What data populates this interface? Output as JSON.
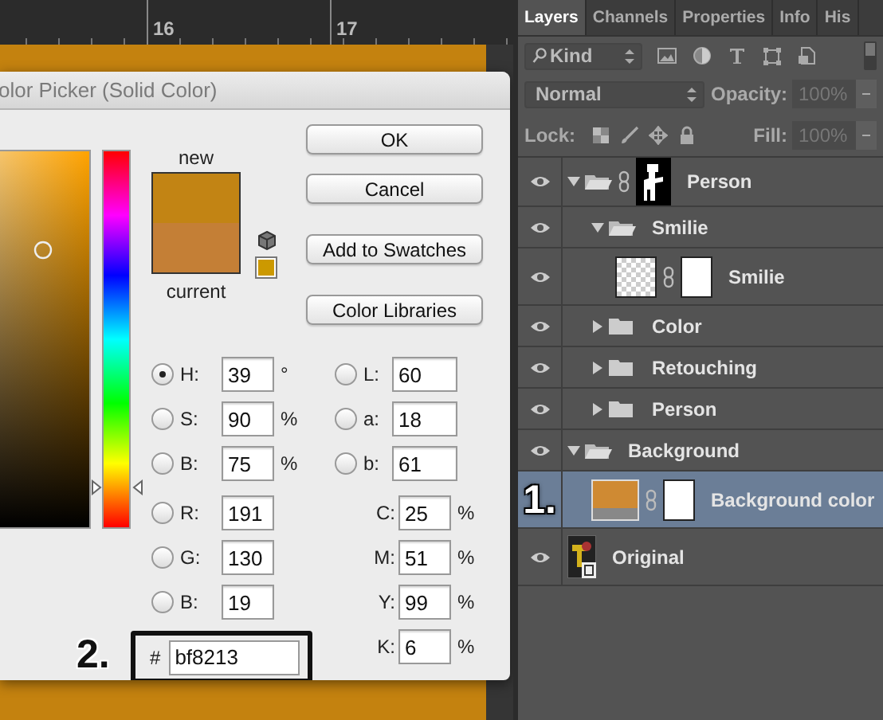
{
  "ruler": {
    "labels": [
      "16",
      "17"
    ]
  },
  "dialog": {
    "title": "olor Picker (Solid Color)",
    "hue_slider": {
      "level": 0.108
    },
    "swatches": [
      {
        "label": "new",
        "color": "#c28414"
      },
      {
        "label": "current",
        "color": "#c47f36"
      }
    ],
    "buttons": [
      "OK",
      "Cancel",
      "Add to Swatches",
      "Color Libraries"
    ],
    "left_fields": [
      {
        "label": "H:",
        "value": "39",
        "unit": "°",
        "kind": "radio",
        "selected": true
      },
      {
        "label": "S:",
        "value": "90",
        "unit": "%",
        "kind": "radio",
        "selected": false
      },
      {
        "label": "B:",
        "value": "75",
        "unit": "%",
        "kind": "radio",
        "selected": false
      },
      {
        "label": "R:",
        "value": "191",
        "kind": "radio",
        "selected": false
      },
      {
        "label": "G:",
        "value": "130",
        "kind": "radio",
        "selected": false
      },
      {
        "label": "B:",
        "value": "19",
        "kind": "radio",
        "selected": false
      }
    ],
    "right_fields": [
      {
        "label": "L:",
        "value": "60",
        "kind": "radio",
        "selected": false
      },
      {
        "label": "a:",
        "value": "18",
        "kind": "radio",
        "selected": false
      },
      {
        "label": "b:",
        "value": "61",
        "kind": "radio",
        "selected": false
      },
      {
        "label": "C:",
        "value": "25",
        "unit": "%",
        "kind": "plain"
      },
      {
        "label": "M:",
        "value": "51",
        "unit": "%",
        "kind": "plain"
      },
      {
        "label": "Y:",
        "value": "99",
        "unit": "%",
        "kind": "plain"
      },
      {
        "label": "K:",
        "value": "6",
        "unit": "%",
        "kind": "plain"
      }
    ],
    "hex": {
      "label": "#",
      "value": "bf8213",
      "callout": "2."
    }
  },
  "panel": {
    "tabs": [
      {
        "label": "Layers",
        "selected": true
      },
      {
        "label": "Channels",
        "selected": false
      },
      {
        "label": "Properties",
        "selected": false
      },
      {
        "label": "Info",
        "selected": false
      },
      {
        "label": "His",
        "selected": false
      }
    ],
    "filter": {
      "value": "Kind"
    },
    "blend_mode": {
      "value": "Normal"
    },
    "opacity": {
      "label": "Opacity:",
      "value": "100%",
      "disabled": true
    },
    "lock": {
      "label": "Lock:"
    },
    "fill": {
      "label": "Fill:",
      "value": "100%",
      "disabled": true
    },
    "layers": [
      {
        "name": "Person",
        "kind": "group",
        "expanded": true,
        "mask": true,
        "selected": false,
        "children": [
          {
            "name": "Smilie",
            "kind": "group",
            "expanded": true,
            "mask": false,
            "selected": false,
            "children": [
              {
                "name": "Smilie",
                "kind": "pixel",
                "mask": true,
                "selected": false
              }
            ]
          },
          {
            "name": "Color",
            "kind": "group",
            "expanded": false,
            "mask": false,
            "selected": false
          },
          {
            "name": "Retouching",
            "kind": "group",
            "expanded": false,
            "mask": false,
            "selected": false
          },
          {
            "name": "Person",
            "kind": "group",
            "expanded": false,
            "mask": false,
            "selected": false
          }
        ]
      },
      {
        "name": "Background",
        "kind": "group",
        "expanded": true,
        "mask": false,
        "selected": false,
        "children": [
          {
            "name": "Background color",
            "kind": "fill",
            "mask": true,
            "selected": true,
            "callout": "1."
          }
        ]
      },
      {
        "name": "Original",
        "kind": "smart",
        "mask": false,
        "selected": false
      }
    ]
  }
}
